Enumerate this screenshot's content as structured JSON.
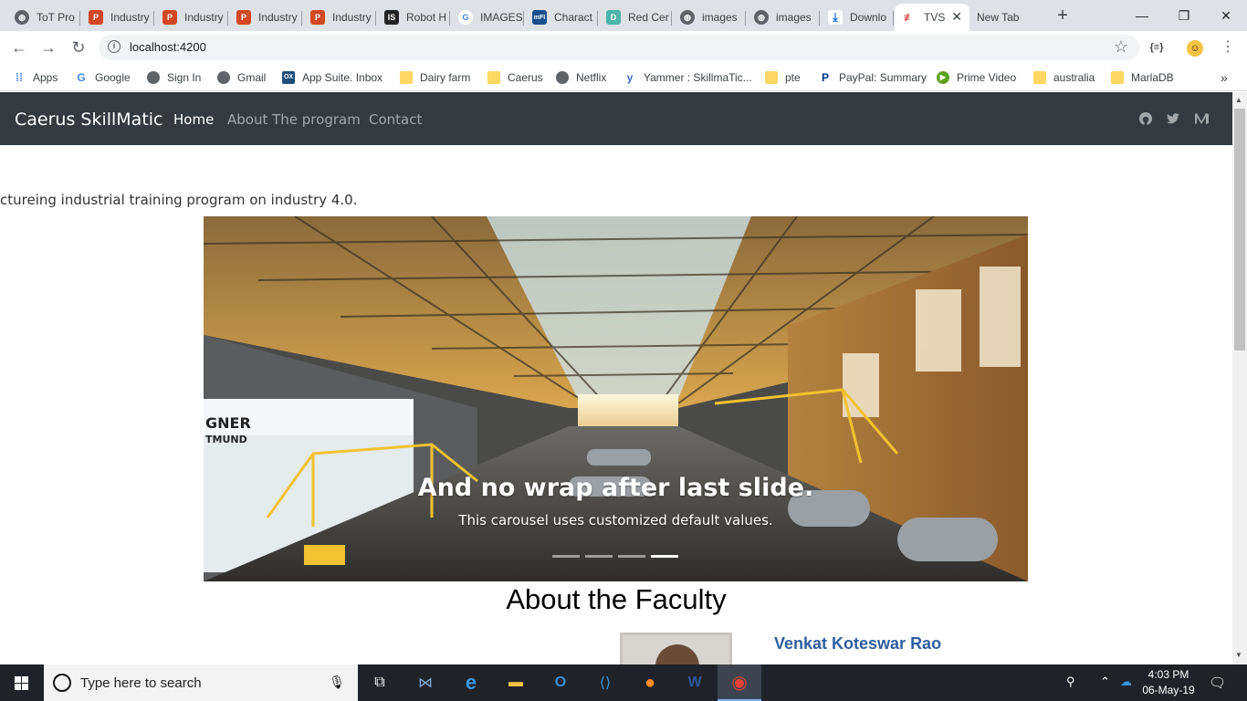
{
  "browser": {
    "tabs": [
      {
        "title": "ToT Pro",
        "icon": "globe-icon",
        "color": "#5f6368"
      },
      {
        "title": "Industry",
        "icon": "powerpoint-icon",
        "color": "#d24726"
      },
      {
        "title": "Industry",
        "icon": "powerpoint-icon",
        "color": "#d24726"
      },
      {
        "title": "Industry",
        "icon": "powerpoint-icon",
        "color": "#d24726"
      },
      {
        "title": "Industry",
        "icon": "powerpoint-icon",
        "color": "#d24726"
      },
      {
        "title": "Robot H",
        "icon": "is-icon",
        "color": "#222222"
      },
      {
        "title": "IMAGES",
        "icon": "google-icon",
        "color": "#4285f4"
      },
      {
        "title": "Charact",
        "icon": "mfi-icon",
        "color": "#1a4f8b"
      },
      {
        "title": "Red Cer",
        "icon": "d-icon",
        "color": "#4db6ac"
      },
      {
        "title": "images",
        "icon": "globe-icon",
        "color": "#5f6368"
      },
      {
        "title": "images",
        "icon": "globe-icon",
        "color": "#5f6368"
      },
      {
        "title": "Downlo",
        "icon": "download-icon",
        "color": "#1a73e8"
      },
      {
        "title": "TVS",
        "icon": "tvs-icon",
        "color": "#d32f2f",
        "active": true
      },
      {
        "title": "New Tab",
        "icon": "",
        "color": "#dee1e6"
      }
    ],
    "url": "localhost:4200",
    "bookmarks": [
      {
        "label": "Apps",
        "icon": "apps-grid-icon"
      },
      {
        "label": "Google",
        "icon": "google-icon"
      },
      {
        "label": "Sign In",
        "icon": "globe-icon"
      },
      {
        "label": "Gmail",
        "icon": "globe-icon"
      },
      {
        "label": "App Suite. Inbox",
        "icon": "ox-icon"
      },
      {
        "label": "Dairy farm",
        "icon": "folder-icon"
      },
      {
        "label": "Caerus",
        "icon": "folder-icon"
      },
      {
        "label": "Netflix",
        "icon": "globe-icon"
      },
      {
        "label": "Yammer : SkillmaTic...",
        "icon": "yammer-icon"
      },
      {
        "label": "pte",
        "icon": "folder-icon"
      },
      {
        "label": "PayPal: Summary",
        "icon": "paypal-icon"
      },
      {
        "label": "Prime Video",
        "icon": "prime-video-icon"
      },
      {
        "label": "australia",
        "icon": "folder-icon"
      },
      {
        "label": "MarlaDB",
        "icon": "folder-icon"
      }
    ]
  },
  "site": {
    "brand": "Caerus SkillMatic",
    "nav": [
      "Home",
      "About The program",
      "Contact"
    ],
    "marquee": "ctureing industrial training program on industry 4.0.",
    "carousel": {
      "caption_title": "And no wrap after last slide.",
      "caption_text": "This carousel uses customized default values.",
      "slides": 4,
      "active_slide": 4,
      "image_text_1": "GNER",
      "image_text_2": "TMUND"
    },
    "faculty": {
      "title": "About the Faculty",
      "name": "Venkat Koteswar Rao"
    }
  },
  "taskbar": {
    "search_placeholder": "Type here to search",
    "time": "4:03 PM",
    "date": "06-May-19"
  }
}
